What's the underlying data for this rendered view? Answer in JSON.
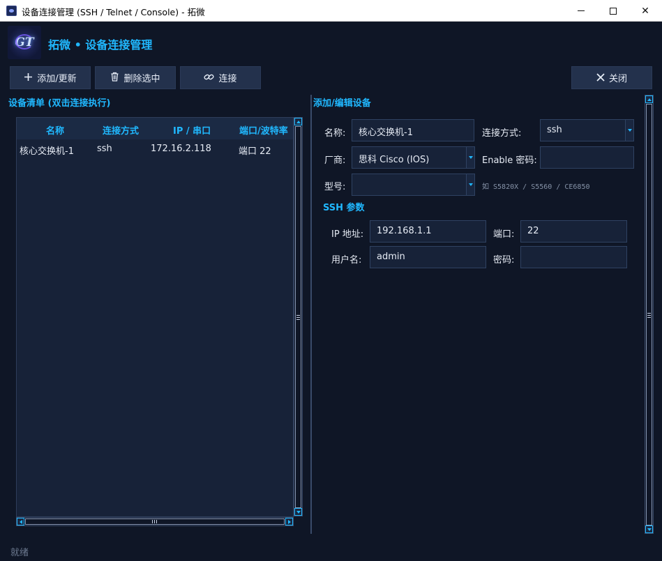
{
  "window": {
    "title": "设备连接管理 (SSH / Telnet / Console) - 拓微",
    "minimize_glyph": "—",
    "maximize_glyph": "☐",
    "close_glyph": "✕"
  },
  "header": {
    "logo_text": "GT",
    "app_title": "拓微 • 设备连接管理"
  },
  "toolbar": {
    "add_label": "添加/更新",
    "add_icon": "plus-icon",
    "delete_label": "删除选中",
    "delete_icon": "trash-icon",
    "connect_label": "连接",
    "connect_icon": "link-icon",
    "close_label": "关闭",
    "close_icon": "close-icon"
  },
  "device_list": {
    "section_title": "设备清单 (双击连接执行)",
    "columns": [
      "名称",
      "连接方式",
      "IP / 串口",
      "端口/波特率"
    ],
    "rows": [
      [
        "核心交换机-1",
        "ssh",
        "172.16.2.118",
        "端口 22"
      ]
    ]
  },
  "editor": {
    "section_title": "添加/编辑设备",
    "name_label": "名称:",
    "name_value": "核心交换机-1",
    "conn_label": "连接方式:",
    "conn_value": "ssh",
    "vendor_label": "厂商:",
    "vendor_value": "思科 Cisco (IOS)",
    "enable_label": "Enable 密码:",
    "enable_value": "",
    "model_label": "型号:",
    "model_value": "",
    "model_hint": "如 S5820X / S5560 / CE6850",
    "ssh_section_title": "SSH 参数",
    "ip_label": "IP 地址:",
    "ip_value": "192.168.1.1",
    "port_label": "端口:",
    "port_value": "22",
    "user_label": "用户名:",
    "user_value": "admin",
    "password_label": "密码:",
    "password_value": ""
  },
  "status": {
    "text": "就绪"
  },
  "colors": {
    "background": "#0f1626",
    "accent": "#20b8ff",
    "button_bg": "#23314c",
    "input_bg": "#172238"
  }
}
